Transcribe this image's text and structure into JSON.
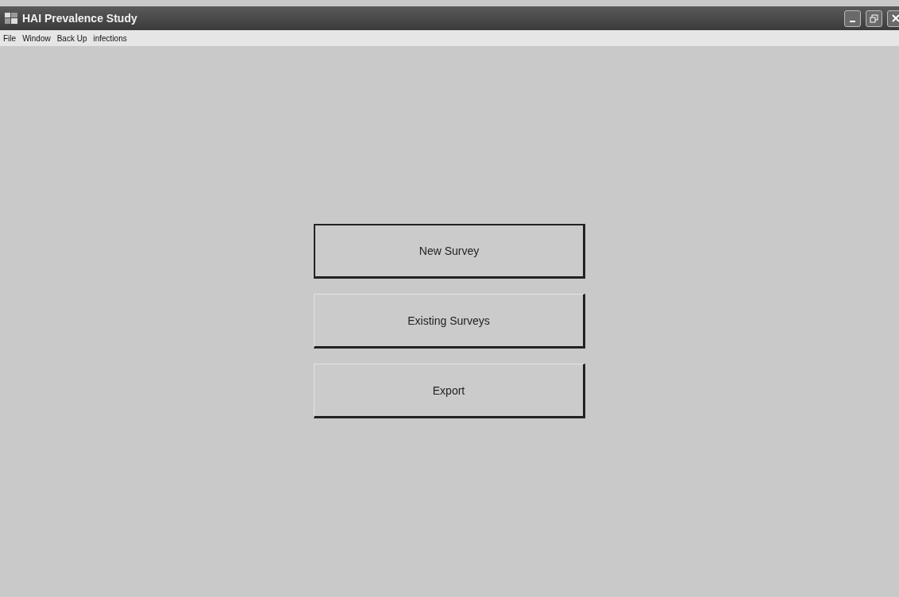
{
  "window": {
    "title": "HAI Prevalence Study"
  },
  "menu": [
    "File",
    "Window",
    "Back Up",
    "infections"
  ],
  "buttons": [
    {
      "label": "New Survey",
      "focused": true
    },
    {
      "label": "Existing Surveys",
      "focused": false
    },
    {
      "label": "Export",
      "focused": false
    }
  ]
}
